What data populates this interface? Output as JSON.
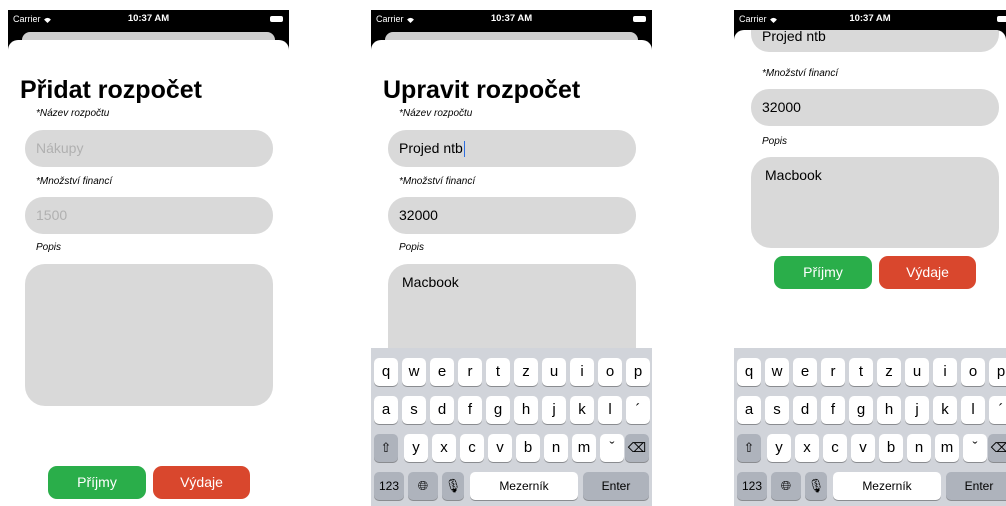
{
  "status": {
    "carrier": "Carrier",
    "time": "10:37 AM"
  },
  "screen1": {
    "title": "Přidat rozpočet",
    "name_label": "*Název rozpočtu",
    "name_placeholder": "Nákupy",
    "amount_label": "*Množství financí",
    "amount_placeholder": "1500",
    "desc_label": "Popis",
    "income_button": "Příjmy",
    "expense_button": "Výdaje"
  },
  "screen2": {
    "title": "Upravit rozpočet",
    "name_label": "*Název rozpočtu",
    "name_value": "Projed ntb",
    "amount_label": "*Množství financí",
    "amount_value": "32000",
    "desc_label": "Popis",
    "desc_value": "Macbook"
  },
  "screen3": {
    "name_value_partial": "Projed ntb",
    "amount_label": "*Množství financí",
    "amount_value": "32000",
    "desc_label": "Popis",
    "desc_value": "Macbook",
    "income_button": "Příjmy",
    "expense_button": "Výdaje"
  },
  "keyboard": {
    "row1": [
      "q",
      "w",
      "e",
      "r",
      "t",
      "z",
      "u",
      "i",
      "o",
      "p"
    ],
    "row2": [
      "a",
      "s",
      "d",
      "f",
      "g",
      "h",
      "j",
      "k",
      "l",
      "´"
    ],
    "row3": [
      "y",
      "x",
      "c",
      "v",
      "b",
      "n",
      "m",
      "ˇ"
    ],
    "shift_icon": "shift-icon",
    "delete_icon": "delete-icon",
    "numbers_label": "123",
    "globe_icon": "globe-icon",
    "mic_icon": "microphone-icon",
    "space_label": "Mezerník",
    "enter_label": "Enter"
  }
}
